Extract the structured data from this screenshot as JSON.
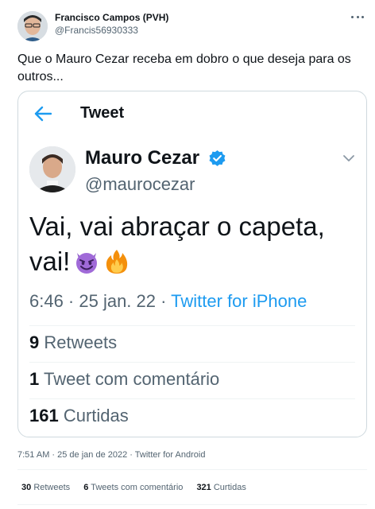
{
  "tweet": {
    "author_name": "Francisco Campos (PVH)",
    "author_handle": "@Francis56930333",
    "text": "Que o Mauro Cezar receba em dobro o que deseja para os outros...",
    "meta": "7:51 AM · 25 de jan de 2022 · Twitter for Android",
    "stats": {
      "retweets_count": "30",
      "retweets_label": "Retweets",
      "quotes_count": "6",
      "quotes_label": "Tweets com comentário",
      "likes_count": "321",
      "likes_label": "Curtidas"
    }
  },
  "embedded": {
    "header_title": "Tweet",
    "author_name": "Mauro Cezar",
    "author_handle": "@maurocezar",
    "text": "Vai, vai abraçar o capeta, vai!",
    "time": "6:46 · 25 jan. 22 · ",
    "source": "Twitter for iPhone",
    "retweets_count": "9",
    "retweets_label": "Retweets",
    "quotes_count": "1",
    "quotes_label": "Tweet com comentário",
    "likes_count": "161",
    "likes_label": "Curtidas"
  },
  "icons": {
    "back": "arrow-left-icon",
    "verified": "verified-badge-icon",
    "chevron": "chevron-down-icon",
    "more": "more-icon",
    "emoji_1": "smiling-devil-emoji",
    "emoji_2": "fire-emoji"
  },
  "colors": {
    "accent": "#1d9bf0",
    "secondary_text": "#536471",
    "primary_text": "#0f1419",
    "border": "#cfd9de"
  }
}
